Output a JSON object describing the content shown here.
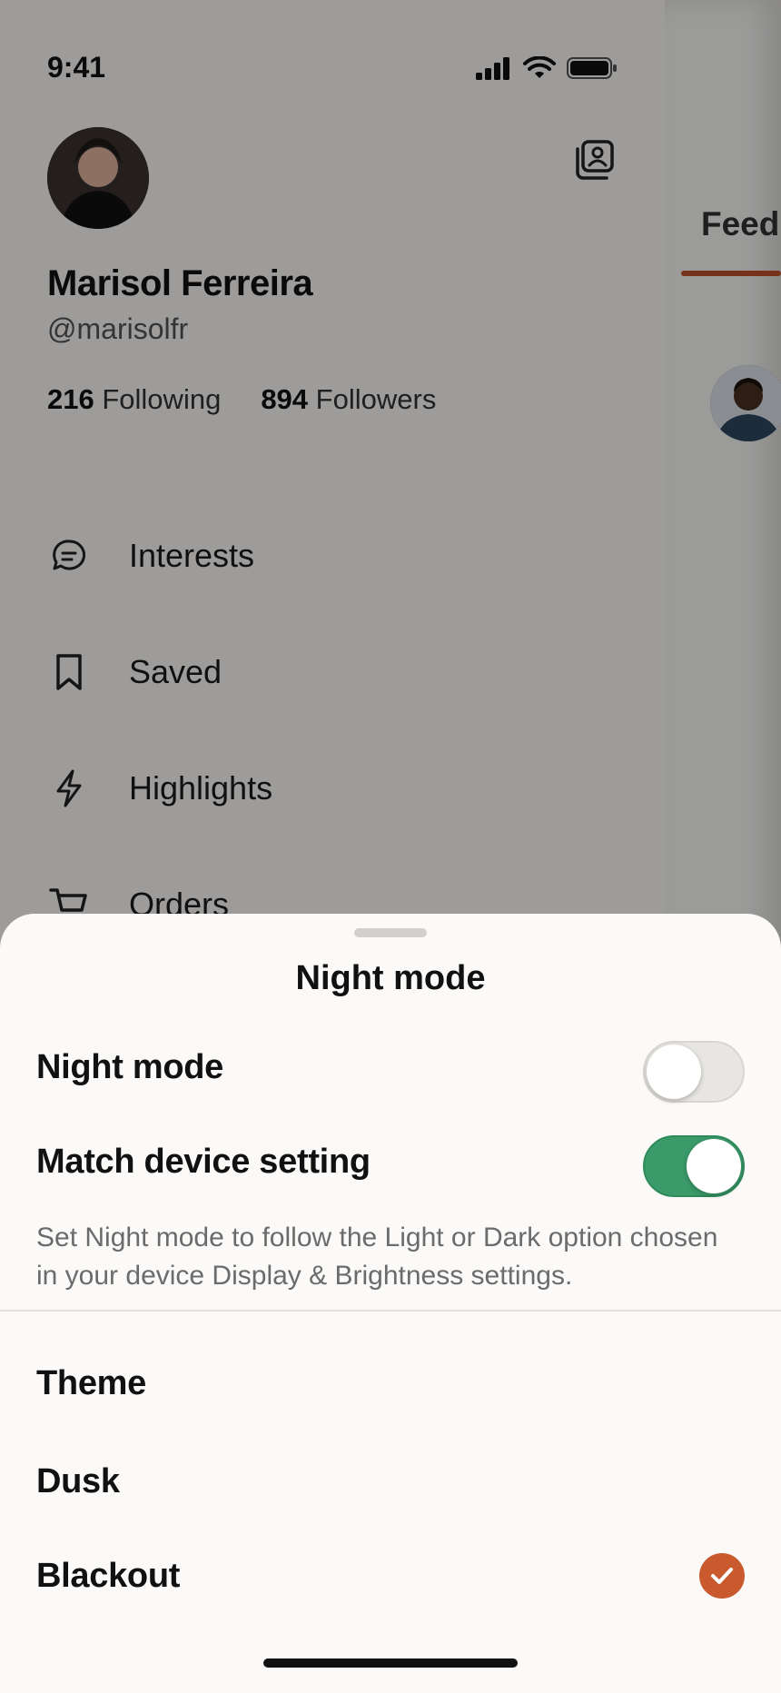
{
  "status_bar": {
    "time": "9:41"
  },
  "profile": {
    "name": "Marisol Ferreira",
    "handle": "@marisolfr",
    "following_count": "216",
    "following_label": "Following",
    "followers_count": "894",
    "followers_label": "Followers"
  },
  "menu": [
    {
      "label": "Interests",
      "icon": "chat-bubble-icon"
    },
    {
      "label": "Saved",
      "icon": "bookmark-icon"
    },
    {
      "label": "Highlights",
      "icon": "lightning-icon"
    },
    {
      "label": "Orders",
      "icon": "cart-icon"
    }
  ],
  "feed": {
    "tab_label": "Feed"
  },
  "sheet": {
    "title": "Night mode",
    "night_mode_label": "Night mode",
    "night_mode_on": false,
    "match_device_label": "Match device setting",
    "match_device_on": true,
    "description": "Set Night mode to follow the Light or Dark option chosen in your device Display & Brightness settings.",
    "theme_heading": "Theme",
    "themes": [
      {
        "label": "Dusk",
        "selected": false
      },
      {
        "label": "Blackout",
        "selected": true
      }
    ]
  },
  "colors": {
    "accent": "#c95a2e",
    "toggle_on": "#3a9a6a"
  }
}
